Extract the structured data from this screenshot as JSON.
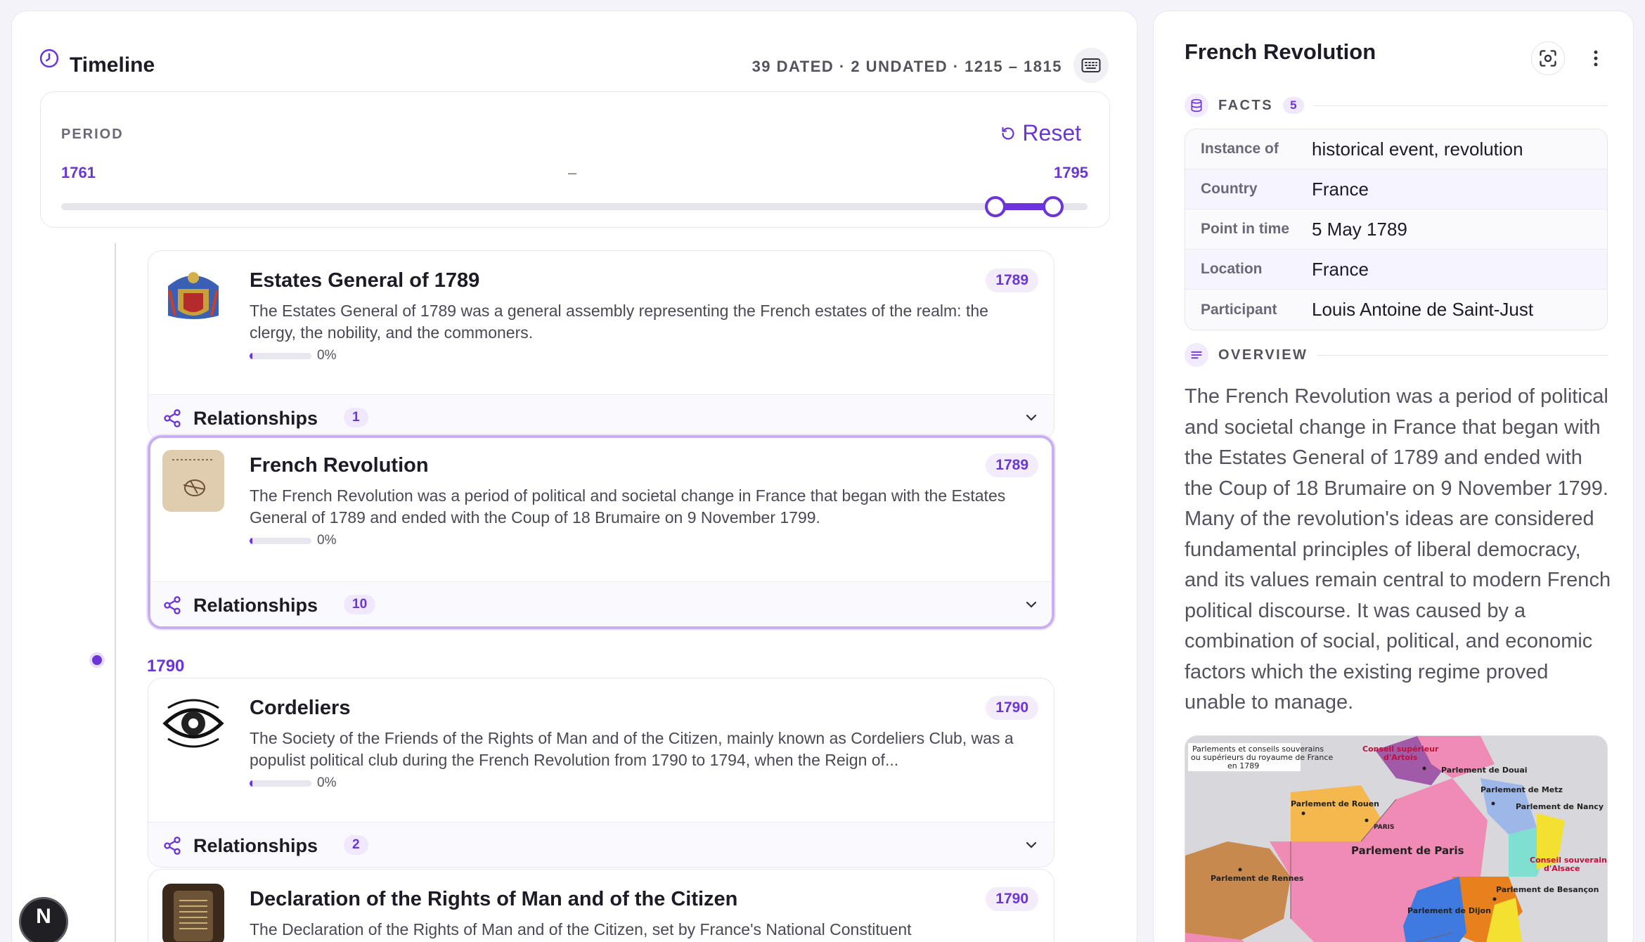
{
  "timeline": {
    "title": "Timeline",
    "summary": "39 DATED · 2 UNDATED · 1215 – 1815",
    "period": {
      "label": "PERIOD",
      "reset_label": "Reset",
      "from": "1761",
      "dash": "–",
      "to": "1795",
      "range_min": 1215,
      "range_max": 1815,
      "selected_from": 1761,
      "selected_to": 1795
    },
    "year_marker": "1790",
    "events": [
      {
        "title": "Estates General of 1789",
        "year": "1789",
        "description": "The Estates General of 1789 was a general assembly representing the French estates of the realm: the clergy, the nobility, and the commoners.",
        "progress": "0%",
        "relationships_label": "Relationships",
        "relationships_count": "1"
      },
      {
        "title": "French Revolution",
        "year": "1789",
        "description": "The French Revolution was a period of political and societal change in France that began with the Estates General of 1789 and ended with the Coup of 18 Brumaire on 9 November 1799.",
        "progress": "0%",
        "relationships_label": "Relationships",
        "relationships_count": "10"
      },
      {
        "title": "Cordeliers",
        "year": "1790",
        "description": "The Society of the Friends of the Rights of Man and of the Citizen, mainly known as Cordeliers Club, was a populist political club during the French Revolution from 1790 to 1794, when the Reign of...",
        "progress": "0%",
        "relationships_label": "Relationships",
        "relationships_count": "2"
      },
      {
        "title": "Declaration of the Rights of Man and of the Citizen",
        "year": "1790",
        "description": "The Declaration of the Rights of Man and of the Citizen, set by France's National Constituent"
      }
    ],
    "floating_badge": "N"
  },
  "detail": {
    "title": "French Revolution",
    "facts_label": "FACTS",
    "facts_count": "5",
    "facts": [
      {
        "key": "Instance of",
        "value": "historical event, revolution"
      },
      {
        "key": "Country",
        "value": "France"
      },
      {
        "key": "Point in time",
        "value": "5 May 1789"
      },
      {
        "key": "Location",
        "value": "France"
      },
      {
        "key": "Participant",
        "value": "Louis Antoine de Saint-Just"
      }
    ],
    "overview_label": "OVERVIEW",
    "overview": "The French Revolution was a period of political and societal change in France that began with the Estates General of 1789 and ended with the Coup of 18 Brumaire on 9 November 1799. Many of the revolution's ideas are considered fundamental principles of liberal democracy, and its values remain central to modern French political discourse. It was caused by a combination of social, political, and economic factors which the existing regime proved unable to manage.",
    "map_labels": {
      "legend": [
        "Parlements et conseils souverains",
        "ou supérieurs du royaume de France",
        "en 1789"
      ],
      "conseil_superieur": "Conseil supérieur",
      "artois": "d'Artois",
      "douai": "Parlement de Douai",
      "metz": "Parlement de Metz",
      "nancy": "Parlement de Nancy",
      "rouen": "Parlement de Rouen",
      "paris_small": "PARIS",
      "paris": "Parlement de Paris",
      "rennes": "Parlement de Rennes",
      "alsace_1": "Conseil souverain",
      "alsace_2": "d'Alsace",
      "besancon": "Parlement de Besançon",
      "dijon": "Parlement de Dijon"
    }
  },
  "colors": {
    "accent": "#6b35d8",
    "accent_soft": "#f2ecfd",
    "selected_border": "#c8b0f0"
  }
}
